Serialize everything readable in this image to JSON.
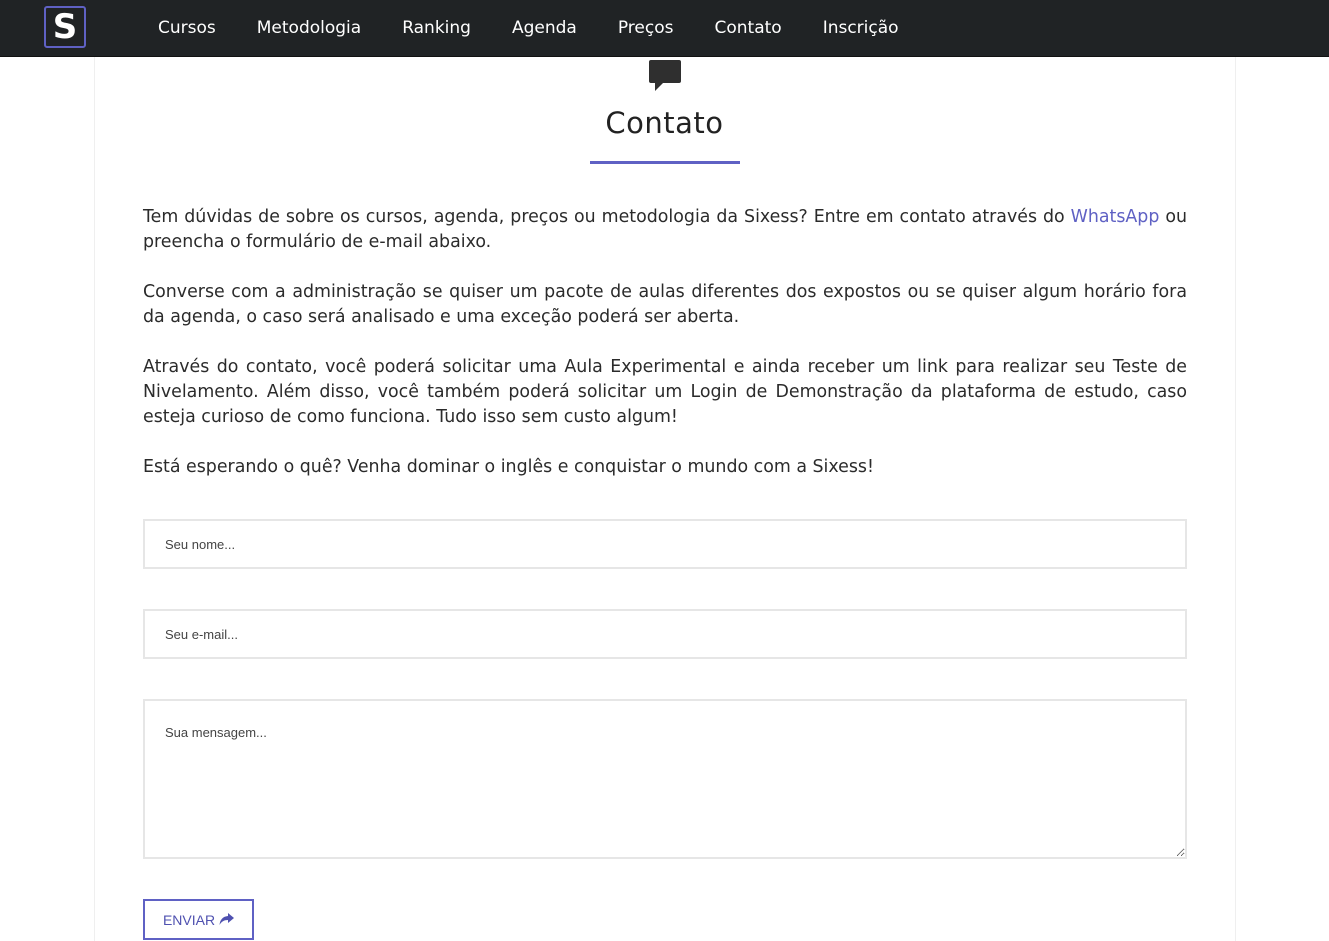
{
  "nav": {
    "logo_letter": "S",
    "items": [
      "Cursos",
      "Metodologia",
      "Ranking",
      "Agenda",
      "Preços",
      "Contato",
      "Inscrição"
    ]
  },
  "section": {
    "icon": "comment-icon",
    "title": "Contato"
  },
  "paragraphs": {
    "p1_before": "Tem dúvidas de sobre os cursos, agenda, preços ou metodologia da Sixess? Entre em contato através do ",
    "p1_link": "WhatsApp",
    "p1_after": " ou preencha o formulário de e-mail abaixo.",
    "p2": "Converse com a administração se quiser um pacote de aulas diferentes dos expostos ou se quiser algum horário fora da agenda, o caso será analisado e uma exceção poderá ser aberta.",
    "p3": "Através do contato, você poderá solicitar uma Aula Experimental e ainda receber um link para realizar seu Teste de Nivelamento. Além disso, você também poderá solicitar um Login de Demonstração da plataforma de estudo, caso esteja curioso de como funciona. Tudo isso sem custo algum!",
    "p4": "Está esperando o quê? Venha dominar o inglês e conquistar o mundo com a Sixess!"
  },
  "form": {
    "name_placeholder": "Seu nome...",
    "email_placeholder": "Seu e-mail...",
    "message_placeholder": "Sua mensagem...",
    "submit_label": "ENVIAR",
    "submit_icon": "share-icon"
  },
  "colors": {
    "accent": "#5f61c4",
    "navbar": "#202325"
  }
}
